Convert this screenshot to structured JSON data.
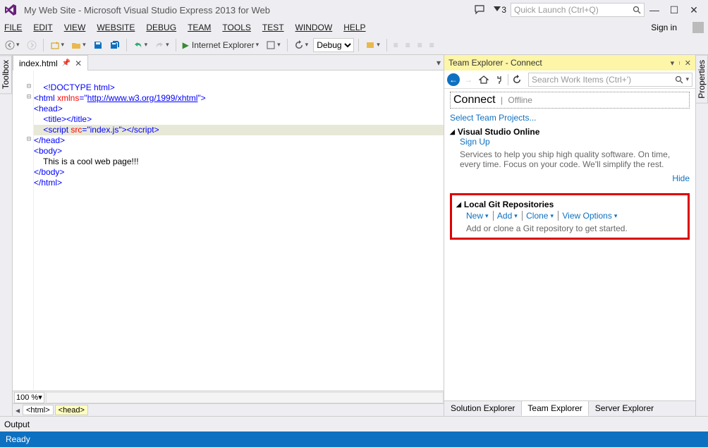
{
  "title": "My Web Site - Microsoft Visual Studio Express 2013 for Web",
  "notifications": "3",
  "quick_launch_placeholder": "Quick Launch (Ctrl+Q)",
  "sign_in": "Sign in",
  "menu": [
    "FILE",
    "EDIT",
    "VIEW",
    "WEBSITE",
    "DEBUG",
    "TEAM",
    "TOOLS",
    "TEST",
    "WINDOW",
    "HELP"
  ],
  "toolbar": {
    "browser": "Internet Explorer",
    "config": "Debug"
  },
  "side_tabs": {
    "left": "Toolbox",
    "right": "Properties"
  },
  "editor_tab": {
    "name": "index.html"
  },
  "zoom": "100 %",
  "breadcrumb": [
    "<html>",
    "<head>"
  ],
  "code": {
    "l1": "<!DOCTYPE html>",
    "l2a": "<html ",
    "l2b": "xmlns",
    "l2c": "=",
    "l2d": "\"",
    "l2e": "http://www.w3.org/1999/xhtml",
    "l2f": "\"",
    "l2g": ">",
    "l3": "<head>",
    "l4a": "<title>",
    "l4b": "</title>",
    "l5a": "<script ",
    "l5b": "src",
    "l5c": "=\"index.js\"",
    "l5d": ">",
    "l5e": "</script>",
    "l6": "</head>",
    "l7": "<body>",
    "l8": "This is a cool web page!!!",
    "l9": "</body>",
    "l10": "</html>"
  },
  "panel": {
    "title": "Team Explorer - Connect",
    "search_placeholder": "Search Work Items (Ctrl+')",
    "connect": "Connect",
    "offline": "Offline",
    "select_projects": "Select Team Projects...",
    "vso_header": "Visual Studio Online",
    "sign_up": "Sign Up",
    "vso_desc": "Services to help you ship high quality software. On time, every time. Focus on your code. We'll simplify the rest.",
    "hide": "Hide",
    "git_header": "Local Git Repositories",
    "git_actions": [
      "New",
      "Add",
      "Clone",
      "View Options"
    ],
    "git_desc": "Add or clone a Git repository to get started.",
    "tabs": [
      "Solution Explorer",
      "Team Explorer",
      "Server Explorer"
    ]
  },
  "output": "Output",
  "status": "Ready"
}
